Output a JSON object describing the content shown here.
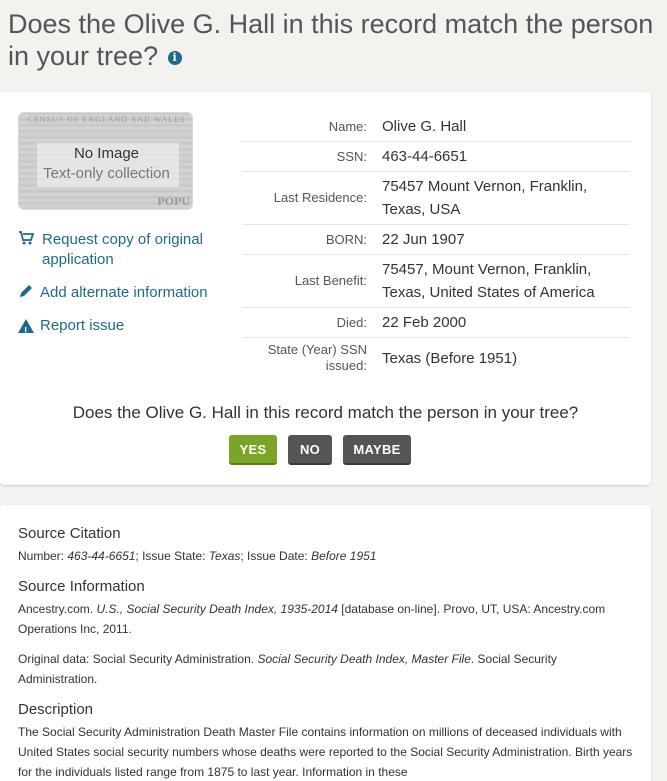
{
  "heading": {
    "text": "Does the Olive G. Hall in this record match the person in your tree?",
    "info_icon": "info-icon"
  },
  "thumbnail": {
    "banner": "CENSUS OF ENGLAND AND WALES",
    "no_image": "No Image",
    "text_only": "Text-only collection",
    "corner_text": "POPU"
  },
  "actions": {
    "request_copy": "Request copy of original application",
    "add_alternate": "Add alternate information",
    "report_issue": "Report issue"
  },
  "facts": [
    {
      "label": "Name:",
      "value": "Olive G. Hall"
    },
    {
      "label": "SSN:",
      "value": "463-44-6651"
    },
    {
      "label": "Last Residence:",
      "value": "75457 Mount Vernon, Franklin, Texas, USA"
    },
    {
      "label": "BORN:",
      "value": "22 Jun 1907"
    },
    {
      "label": "Last Benefit:",
      "value": "75457, Mount Vernon, Franklin, Texas, United States of America"
    },
    {
      "label": "Died:",
      "value": "22 Feb 2000"
    },
    {
      "label": "State (Year) SSN issued:",
      "value": "Texas (Before 1951)"
    }
  ],
  "match": {
    "question": "Does the Olive G. Hall in this record match the person in your tree?",
    "yes": "YES",
    "no": "NO",
    "maybe": "MAYBE"
  },
  "citation": {
    "title": "Source Citation",
    "number_label": "Number: ",
    "number_value": "463-44-6651",
    "state_label": "; Issue State: ",
    "state_value": "Texas",
    "date_label": "; Issue Date: ",
    "date_value": "Before 1951"
  },
  "source_info": {
    "title": "Source Information",
    "p1_a": "Ancestry.com. ",
    "p1_b": "U.S., Social Security Death Index, 1935-2014",
    "p1_c": " [database on-line]. Provo, UT, USA: Ancestry.com Operations Inc, 2011.",
    "p2_a": "Original data: Social Security Administration. ",
    "p2_b": "Social Security Death Index, Master File",
    "p2_c": ". Social Security Administration."
  },
  "description": {
    "title": "Description",
    "text": "The Social Security Administration Death Master File contains information on millions of deceased individuals with United States social security numbers whose deaths were reported to the Social Security Administration. Birth years for the individuals listed range from 1875 to last year. Information in these"
  },
  "colors": {
    "accent_link": "#1e6a89",
    "yes_green": "#7ba524",
    "button_gray": "#555555",
    "page_bg": "#f4f2ef"
  }
}
